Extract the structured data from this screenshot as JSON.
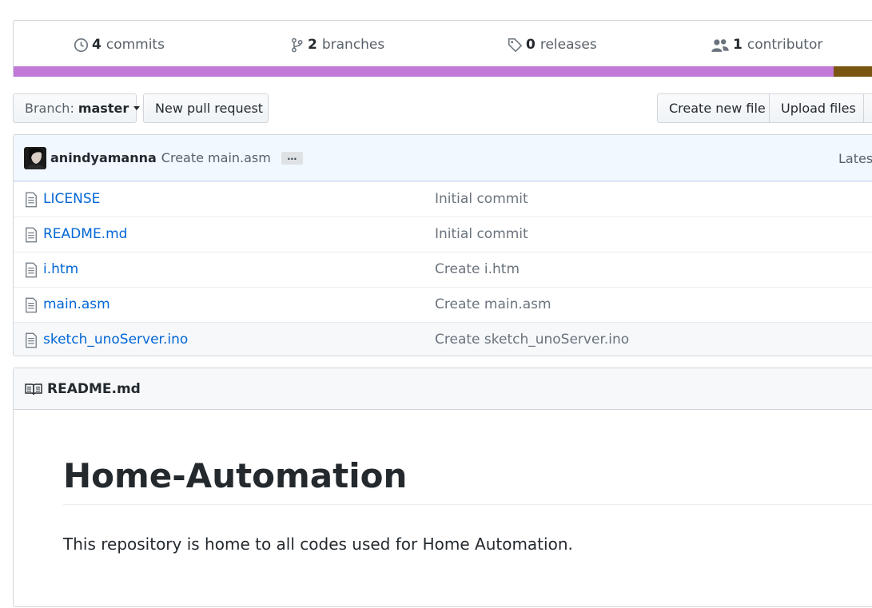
{
  "summary": {
    "commits": {
      "count": "4",
      "label": "commits",
      "icon": "history-icon"
    },
    "branches": {
      "count": "2",
      "label": "branches",
      "icon": "branch-icon"
    },
    "releases": {
      "count": "0",
      "label": "releases",
      "icon": "tag-icon"
    },
    "contributors": {
      "count": "1",
      "label": "contributor",
      "icon": "people-icon"
    }
  },
  "language_bar": {
    "segments": [
      {
        "color": "#c17ad7",
        "fraction": 0.943
      },
      {
        "color": "#7a5512",
        "fraction": 0.057
      }
    ]
  },
  "toolbar": {
    "branch_prefix": "Branch:",
    "branch_name": "master",
    "new_pull_request": "New pull request",
    "create_new_file": "Create new file",
    "upload_files": "Upload files"
  },
  "commit_tease": {
    "author": "anindyamanna",
    "message": "Create main.asm",
    "ellipsis": "…",
    "latest": "Lates"
  },
  "files": [
    {
      "name": "LICENSE",
      "message": "Initial commit"
    },
    {
      "name": "README.md",
      "message": "Initial commit"
    },
    {
      "name": "i.htm",
      "message": "Create i.htm"
    },
    {
      "name": "main.asm",
      "message": "Create main.asm"
    },
    {
      "name": "sketch_unoServer.ino",
      "message": "Create sketch_unoServer.ino"
    }
  ],
  "readme": {
    "filename": "README.md",
    "title": "Home-Automation",
    "body": "This repository is home to all codes used for Home Automation."
  },
  "colors": {
    "link": "#0366d6",
    "muted": "#586069",
    "commit_bg": "#f1f8ff"
  }
}
